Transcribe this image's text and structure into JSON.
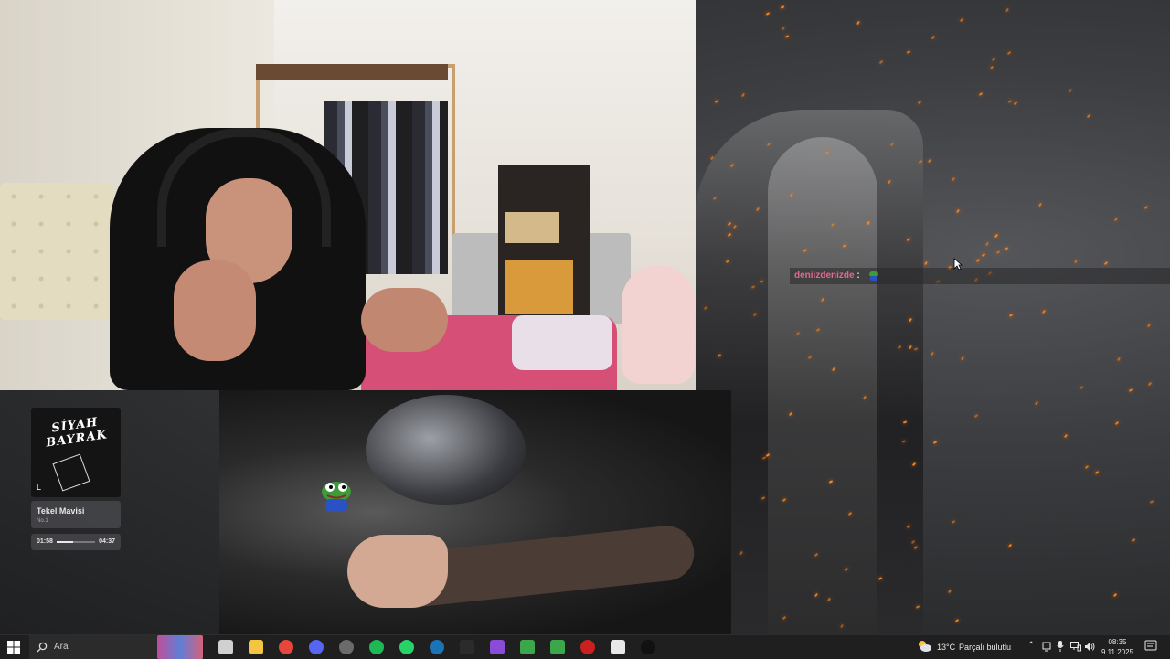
{
  "chat": {
    "username": "deniizdenizde",
    "separator": ":"
  },
  "music_widget": {
    "album_title": "SİYAH BAYRAK",
    "album_corner_mark": "L",
    "track_title": "Tekel Mavisi",
    "track_subtitle": "No.1",
    "current_time": "01:58",
    "total_time": "04:37",
    "progress_fraction": 0.43
  },
  "taskbar": {
    "search_label": "Ara",
    "pinned_icons": [
      "task-view-icon",
      "file-explorer-icon",
      "chrome-icon",
      "discord-icon",
      "obs-icon",
      "spotify-icon",
      "whatsapp-icon",
      "steam-icon",
      "epic-games-icon",
      "visual-studio-icon",
      "app-icon",
      "app-icon",
      "red-app-icon",
      "capcut-icon",
      "tiktok-icon"
    ],
    "weather": {
      "temperature": "13°C",
      "condition": "Parçalı bulutlu"
    },
    "clock": {
      "time": "08:35",
      "date": "9.11.2025"
    }
  },
  "colors": {
    "chat_username": "#e06a8c",
    "taskbar_bg": "#1f1f1f",
    "ember": "#ff8a1f"
  }
}
